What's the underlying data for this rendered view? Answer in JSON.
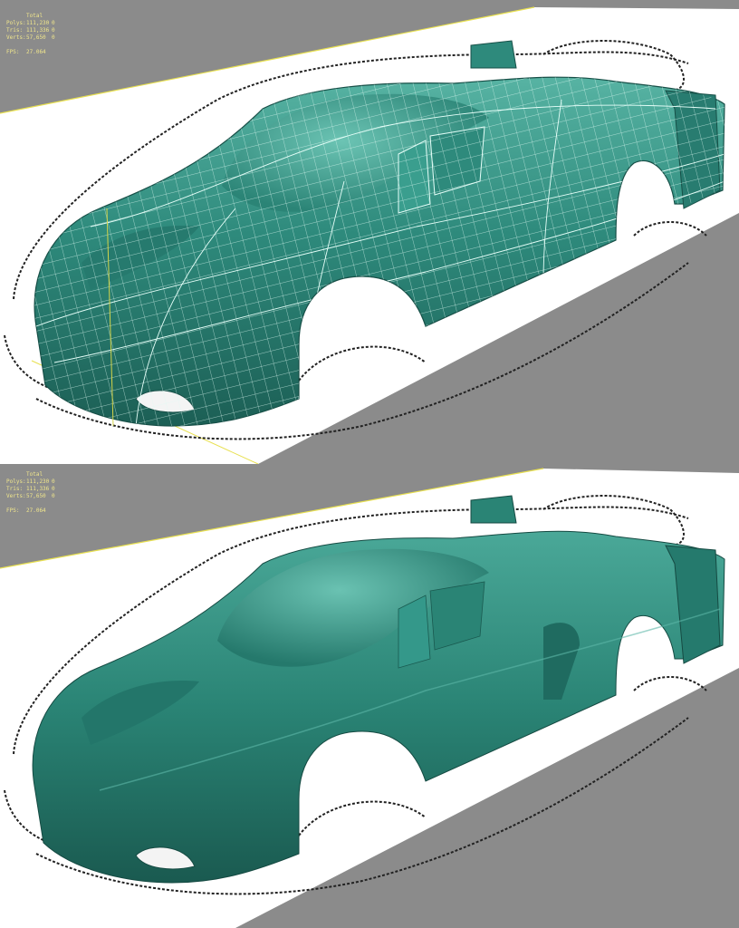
{
  "viewports": [
    {
      "name": "wireframe-shaded",
      "shading": "smooth + edged faces",
      "stats": {
        "header": "Total",
        "rows": [
          {
            "label": "Polys:",
            "total": "111,230",
            "selected": "0"
          },
          {
            "label": "Tris:",
            "total": "111,336",
            "selected": "0"
          },
          {
            "label": "Verts:",
            "total": "57,650",
            "selected": "0"
          }
        ],
        "fps_label": "FPS:",
        "fps_value": "27.064"
      }
    },
    {
      "name": "smooth-shaded",
      "shading": "smooth",
      "stats": {
        "header": "Total",
        "rows": [
          {
            "label": "Polys:",
            "total": "111,230",
            "selected": "0"
          },
          {
            "label": "Tris:",
            "total": "111,336",
            "selected": "0"
          },
          {
            "label": "Verts:",
            "total": "57,650",
            "selected": "0"
          }
        ],
        "fps_label": "FPS:",
        "fps_value": "27.064"
      }
    }
  ],
  "colors": {
    "background": "#8b8b8b",
    "blueprint_plane": "#ffffff",
    "model_teal": "#2e8a7c",
    "model_teal_dark": "#1c5f55",
    "model_teal_light": "#5cb8a8",
    "wire": "#e6fff9",
    "stats_text": "#f0e68c"
  }
}
